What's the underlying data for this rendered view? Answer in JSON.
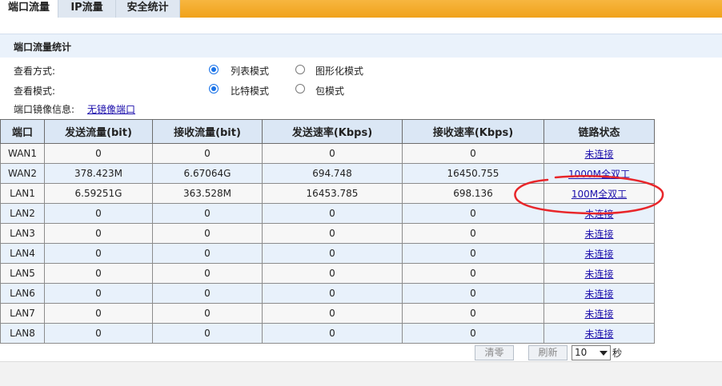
{
  "tabs": [
    {
      "label": "端口流量",
      "active": true
    },
    {
      "label": "IP流量",
      "active": false
    },
    {
      "label": "安全统计",
      "active": false
    }
  ],
  "section_title": "端口流量统计",
  "view_method": {
    "label": "查看方式:",
    "options": [
      {
        "label": "列表模式",
        "checked": true
      },
      {
        "label": "图形化模式",
        "checked": false
      }
    ]
  },
  "view_mode": {
    "label": "查看模式:",
    "options": [
      {
        "label": "比特模式",
        "checked": true
      },
      {
        "label": "包模式",
        "checked": false
      }
    ]
  },
  "mirror": {
    "label": "端口镜像信息:",
    "link": "无镜像端口"
  },
  "table": {
    "headers": [
      "端口",
      "发送流量(bit)",
      "接收流量(bit)",
      "发送速率(Kbps)",
      "接收速率(Kbps)",
      "链路状态"
    ],
    "rows": [
      [
        "WAN1",
        "0",
        "0",
        "0",
        "0",
        "未连接"
      ],
      [
        "WAN2",
        "378.423M",
        "6.67064G",
        "694.748",
        "16450.755",
        "1000M全双工"
      ],
      [
        "LAN1",
        "6.59251G",
        "363.528M",
        "16453.785",
        "698.136",
        "100M全双工"
      ],
      [
        "LAN2",
        "0",
        "0",
        "0",
        "0",
        "未连接"
      ],
      [
        "LAN3",
        "0",
        "0",
        "0",
        "0",
        "未连接"
      ],
      [
        "LAN4",
        "0",
        "0",
        "0",
        "0",
        "未连接"
      ],
      [
        "LAN5",
        "0",
        "0",
        "0",
        "0",
        "未连接"
      ],
      [
        "LAN6",
        "0",
        "0",
        "0",
        "0",
        "未连接"
      ],
      [
        "LAN7",
        "0",
        "0",
        "0",
        "0",
        "未连接"
      ],
      [
        "LAN8",
        "0",
        "0",
        "0",
        "0",
        "未连接"
      ]
    ]
  },
  "controls": {
    "clear_label": "清零",
    "refresh_label": "刷新",
    "interval_value": "10",
    "interval_unit": "秒"
  },
  "colors": {
    "tab_bar": "#f5a623",
    "link": "#1a0dab",
    "annotation": "#e8262a",
    "radio_checked": "#1a73e8"
  }
}
